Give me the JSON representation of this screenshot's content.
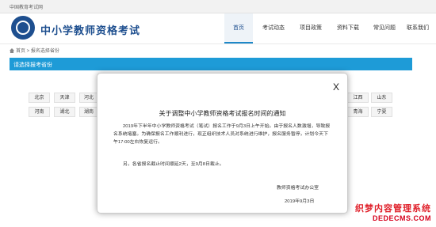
{
  "topbar": {
    "text": "中国教育考试网"
  },
  "header": {
    "site_title": "中小学教师资格考试",
    "nav": [
      {
        "label": "首页",
        "active": true
      },
      {
        "label": "考试动态",
        "active": false
      },
      {
        "label": "项目政策",
        "active": false
      },
      {
        "label": "资料下载",
        "active": false
      },
      {
        "label": "常见问题",
        "active": false
      },
      {
        "label": "联系我们",
        "active": false
      }
    ]
  },
  "breadcrumb": {
    "home": "首页",
    "separator": " > ",
    "current": "报名选择省份"
  },
  "section": {
    "title": "请选择报考省份"
  },
  "provinces": {
    "row1": [
      "北京",
      "天津",
      "河北",
      "江西",
      "山东"
    ],
    "row2": [
      "河南",
      "湖北",
      "湖南",
      "青海",
      "宁夏"
    ]
  },
  "modal": {
    "close_label": "X",
    "title": "关于调整中小学教师资格考试报名时间的通知",
    "body": "2019年下半年中小学教师资格考试（笔试）报名工作于9月3日上午开始。由于报名人数激增，导致报名系统堵塞。为确保报名工作顺利进行，现正组织技术人员对系统进行维护，报名服务暂停，计划今天下午17:00左右恢复运行。",
    "note": "另，各省报名截止时间顺延2天，至9月8日截止。",
    "org": "教师资格考试办公室",
    "date": "2019年9月3日"
  },
  "watermark": {
    "line1": "织梦内容管理系统",
    "line2": "DEDECMS.COM"
  },
  "colors": {
    "brand": "#1e4f8f",
    "section_bar": "#1e9bd7",
    "watermark": "#e0212b"
  }
}
